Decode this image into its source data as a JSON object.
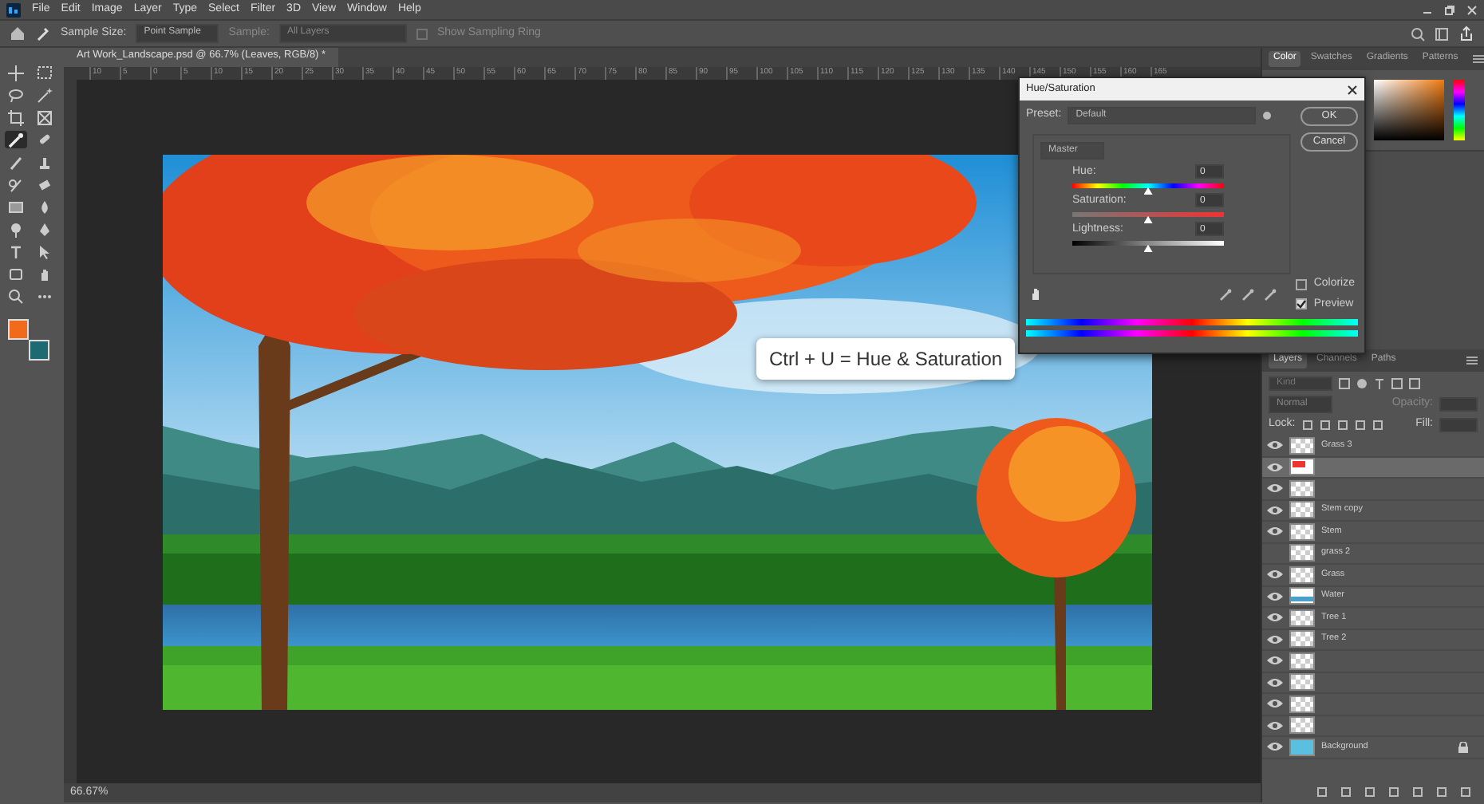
{
  "menu": [
    "File",
    "Edit",
    "Image",
    "Layer",
    "Type",
    "Select",
    "Filter",
    "3D",
    "View",
    "Window",
    "Help"
  ],
  "options_bar": {
    "sample_size_label": "Sample Size:",
    "sample_size_value": "Point Sample",
    "sample_label": "Sample:",
    "sample_value": "All Layers",
    "show_sampling_ring": {
      "label": "Show Sampling Ring",
      "checked": false,
      "disabled": true
    }
  },
  "document_tab": {
    "title": "Art Work_Landscape.psd @ 66.7% (Leaves, RGB/8) *"
  },
  "ruler_marks": [
    "10",
    "5",
    "0",
    "5",
    "10",
    "15",
    "20",
    "25",
    "30",
    "35",
    "40",
    "45",
    "50",
    "55",
    "60",
    "65",
    "70",
    "75",
    "80",
    "85",
    "90",
    "95",
    "100",
    "105",
    "110",
    "115",
    "120",
    "125",
    "130",
    "135",
    "140",
    "145",
    "150",
    "155",
    "160",
    "165"
  ],
  "tools": [
    {
      "kind": "move",
      "selected": false
    },
    {
      "kind": "marquee",
      "selected": false
    },
    {
      "kind": "lasso",
      "selected": false
    },
    {
      "kind": "wand",
      "selected": false
    },
    {
      "kind": "crop",
      "selected": false
    },
    {
      "kind": "frame",
      "selected": false
    },
    {
      "kind": "eyedropper",
      "selected": true
    },
    {
      "kind": "bandage",
      "selected": false
    },
    {
      "kind": "brush",
      "selected": false
    },
    {
      "kind": "stamp",
      "selected": false
    },
    {
      "kind": "history",
      "selected": false
    },
    {
      "kind": "eraser",
      "selected": false
    },
    {
      "kind": "gradient",
      "selected": false
    },
    {
      "kind": "blur",
      "selected": false
    },
    {
      "kind": "dodge",
      "selected": false
    },
    {
      "kind": "pen",
      "selected": false
    },
    {
      "kind": "type",
      "selected": false
    },
    {
      "kind": "arrow",
      "selected": false
    },
    {
      "kind": "shape",
      "selected": false
    },
    {
      "kind": "hand",
      "selected": false
    },
    {
      "kind": "zoom",
      "selected": false
    },
    {
      "kind": "more",
      "selected": false
    }
  ],
  "callout": {
    "text": "Ctrl + U = Hue & Saturation"
  },
  "status_bar": {
    "zoom": "66.67%"
  },
  "hue_saturation_dialog": {
    "title": "Hue/Saturation",
    "preset_label": "Preset:",
    "preset_value": "Default",
    "ok": "OK",
    "cancel": "Cancel",
    "channel": "Master",
    "sliders": [
      {
        "label": "Hue:",
        "value": "0",
        "level": 0.5,
        "kind": "hue"
      },
      {
        "label": "Saturation:",
        "value": "0",
        "level": 0.5,
        "kind": "saturation"
      },
      {
        "label": "Lightness:",
        "value": "0",
        "level": 0.5,
        "kind": "lightness"
      }
    ],
    "colorize": {
      "label": "Colorize",
      "checked": false
    },
    "preview": {
      "label": "Preview",
      "checked": true
    }
  },
  "right_panel": {
    "color_tabs": [
      {
        "label": "Color",
        "selected": true
      },
      {
        "label": "Swatches",
        "selected": false
      },
      {
        "label": "Gradients",
        "selected": false
      },
      {
        "label": "Patterns",
        "selected": false
      }
    ],
    "layer_tabs": [
      {
        "label": "Layers",
        "selected": true
      },
      {
        "label": "Channels",
        "selected": false
      },
      {
        "label": "Paths",
        "selected": false
      }
    ],
    "filter_placeholder": "Kind",
    "blend_mode": "Normal",
    "opacity_label": "Opacity:",
    "lock_label": "Lock:",
    "fill_label": "Fill:",
    "layers": [
      {
        "name": "Grass 3",
        "visible": true,
        "selected": false,
        "kind": "transparent"
      },
      {
        "visible": true,
        "selected": true,
        "kind": "leaves"
      },
      {
        "visible": true,
        "selected": false,
        "kind": "transparent"
      },
      {
        "name": "Stem copy",
        "visible": true,
        "selected": false,
        "kind": "transparent"
      },
      {
        "name": "Stem",
        "visible": true,
        "selected": false,
        "kind": "transparent"
      },
      {
        "name": "grass 2",
        "visible": false,
        "selected": false,
        "kind": "transparent"
      },
      {
        "name": "Grass",
        "visible": true,
        "selected": false,
        "kind": "transparent"
      },
      {
        "name": "Water",
        "visible": true,
        "selected": false,
        "kind": "water"
      },
      {
        "name": "Tree 1",
        "visible": true,
        "selected": false,
        "kind": "transparent"
      },
      {
        "name": "Tree 2",
        "visible": true,
        "selected": false,
        "kind": "transparent"
      },
      {
        "visible": true,
        "selected": false,
        "kind": "transparent"
      },
      {
        "visible": true,
        "selected": false,
        "kind": "transparent"
      },
      {
        "visible": true,
        "selected": false,
        "kind": "transparent"
      },
      {
        "visible": true,
        "selected": false,
        "kind": "transparent"
      },
      {
        "name": "Background",
        "visible": true,
        "selected": false,
        "kind": "sky",
        "locked": true
      }
    ]
  }
}
